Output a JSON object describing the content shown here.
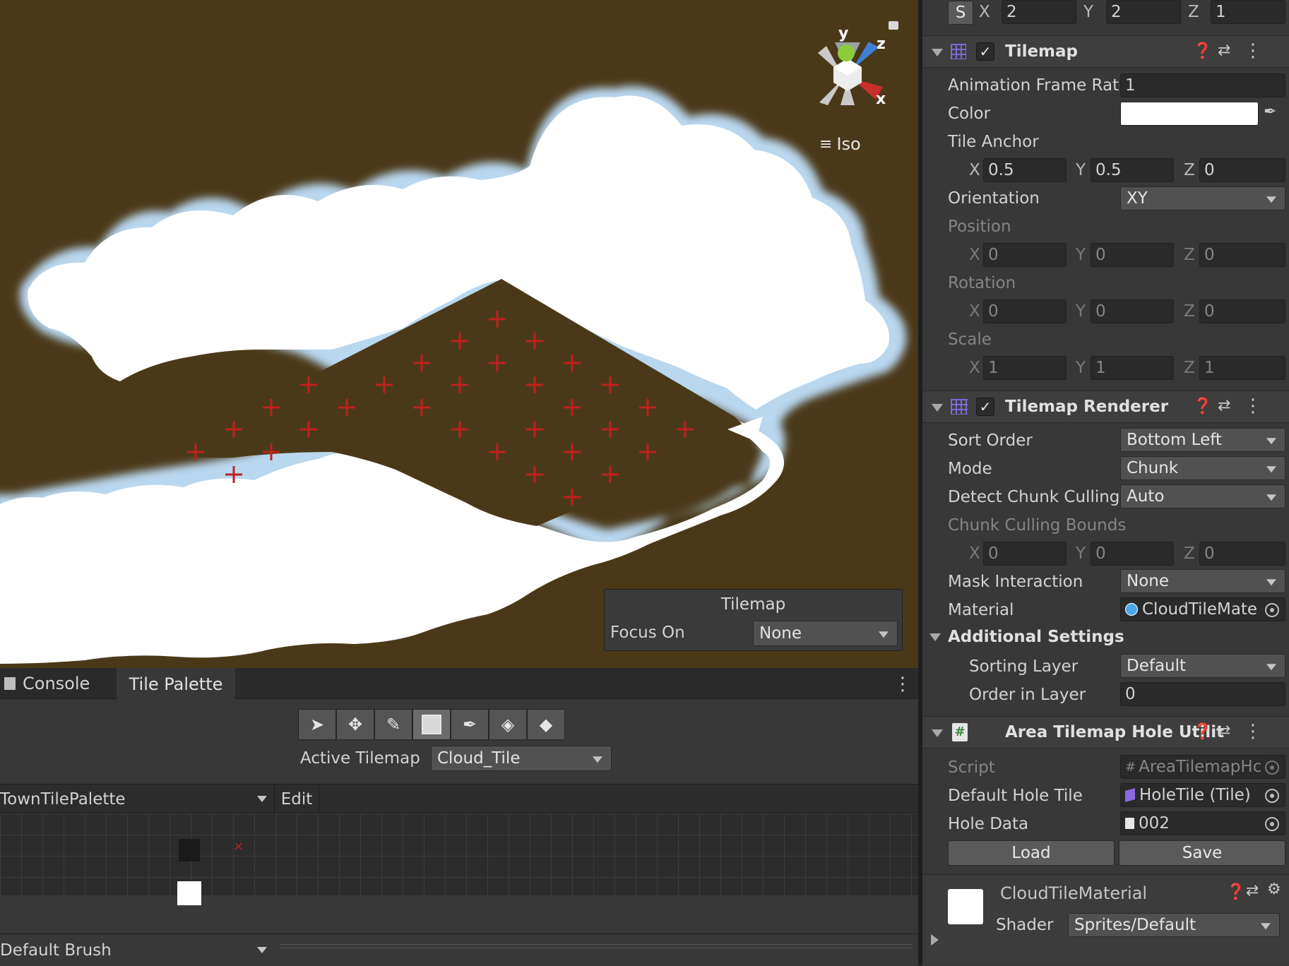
{
  "scene": {
    "persp_label": "Iso",
    "gizmo": {
      "x": "x",
      "y": "y",
      "z": "z"
    },
    "overlay": {
      "title": "Tilemap",
      "focus_label": "Focus On",
      "focus_value": "None"
    }
  },
  "inspector": {
    "transform_scale": {
      "s_button": "S",
      "x_label": "X",
      "x": "2",
      "y_label": "Y",
      "y": "2",
      "z_label": "Z",
      "z": "1"
    },
    "tilemap": {
      "title": "Tilemap",
      "anim_rate_label": "Animation Frame Rate",
      "anim_rate": "1",
      "color_label": "Color",
      "color_value": "#ffffff",
      "tile_anchor_label": "Tile Anchor",
      "anchor": {
        "x_label": "X",
        "x": "0.5",
        "y_label": "Y",
        "y": "0.5",
        "z_label": "Z",
        "z": "0"
      },
      "orientation_label": "Orientation",
      "orientation": "XY",
      "position_label": "Position",
      "position": {
        "x_label": "X",
        "x": "0",
        "y_label": "Y",
        "y": "0",
        "z_label": "Z",
        "z": "0"
      },
      "rotation_label": "Rotation",
      "rotation": {
        "x_label": "X",
        "x": "0",
        "y_label": "Y",
        "y": "0",
        "z_label": "Z",
        "z": "0"
      },
      "scale_label": "Scale",
      "scale": {
        "x_label": "X",
        "x": "1",
        "y_label": "Y",
        "y": "1",
        "z_label": "Z",
        "z": "1"
      }
    },
    "renderer": {
      "title": "Tilemap Renderer",
      "sort_order_label": "Sort Order",
      "sort_order": "Bottom Left",
      "mode_label": "Mode",
      "mode": "Chunk",
      "detect_label": "Detect Chunk Culling",
      "detect": "Auto",
      "bounds_label": "Chunk Culling Bounds",
      "bounds": {
        "x_label": "X",
        "x": "0",
        "y_label": "Y",
        "y": "0",
        "z_label": "Z",
        "z": "0"
      },
      "mask_label": "Mask Interaction",
      "mask": "None",
      "material_label": "Material",
      "material": "CloudTileMate",
      "additional_label": "Additional Settings",
      "sorting_layer_label": "Sorting Layer",
      "sorting_layer": "Default",
      "order_label": "Order in Layer",
      "order": "0"
    },
    "hole_util": {
      "title": "Area Tilemap Hole Utilit",
      "script_label": "Script",
      "script": "AreaTilemapHc",
      "default_hole_label": "Default Hole Tile",
      "default_hole": "HoleTile (Tile)",
      "hole_data_label": "Hole Data",
      "hole_data": "002",
      "load": "Load",
      "save": "Save"
    },
    "material": {
      "name": "CloudTileMaterial",
      "shader_label": "Shader",
      "shader": "Sprites/Default"
    }
  },
  "bottom": {
    "tabs": [
      "Console",
      "Tile Palette"
    ],
    "active_tilemap_label": "Active Tilemap",
    "active_tilemap": "Cloud_Tile",
    "palette": "TownTilePalette",
    "edit": "Edit",
    "brush": "Default Brush"
  },
  "colors": {
    "scene_bg": "#4a3919",
    "cloud": "#ffffff",
    "cross": "#c0201c",
    "panel": "#383838"
  }
}
